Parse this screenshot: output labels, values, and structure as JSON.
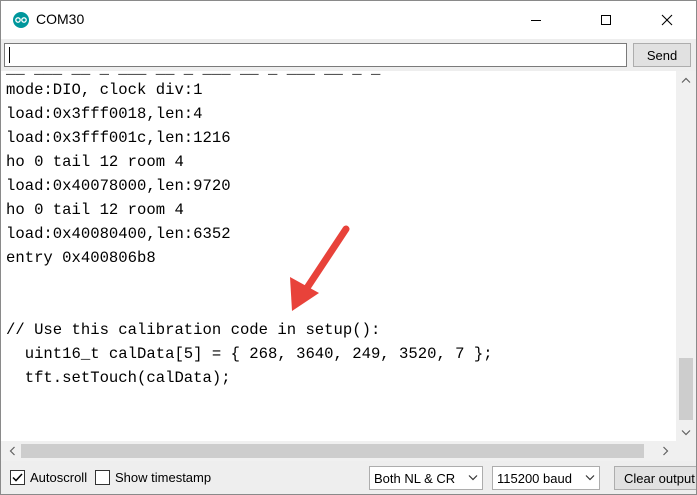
{
  "window": {
    "title": "COM30",
    "minimize_icon": "minimize-icon",
    "maximize_icon": "maximize-icon",
    "close_icon": "close-icon"
  },
  "input": {
    "value": "",
    "send_label": "Send"
  },
  "output": {
    "clipped_top_line": "__ ___ __ _ ___ __ _ ___ __ _ ___ __ _ _",
    "lines": [
      "mode:DIO, clock div:1",
      "load:0x3fff0018,len:4",
      "load:0x3fff001c,len:1216",
      "ho 0 tail 12 room 4",
      "load:0x40078000,len:9720",
      "ho 0 tail 12 room 4",
      "load:0x40080400,len:6352",
      "entry 0x400806b8",
      "",
      "",
      "// Use this calibration code in setup():",
      "  uint16_t calData[5] = { 268, 3640, 249, 3520, 7 };",
      "  tft.setTouch(calData);"
    ]
  },
  "annotation": {
    "arrow_color": "#e8423a"
  },
  "footer": {
    "autoscroll_label": "Autoscroll",
    "autoscroll_checked": true,
    "timestamp_label": "Show timestamp",
    "timestamp_checked": false,
    "line_ending": "Both NL & CR",
    "baud_rate": "115200 baud",
    "clear_label": "Clear output"
  },
  "colors": {
    "app_icon": "#00979c",
    "toolbar_bg": "#eeeeee"
  }
}
